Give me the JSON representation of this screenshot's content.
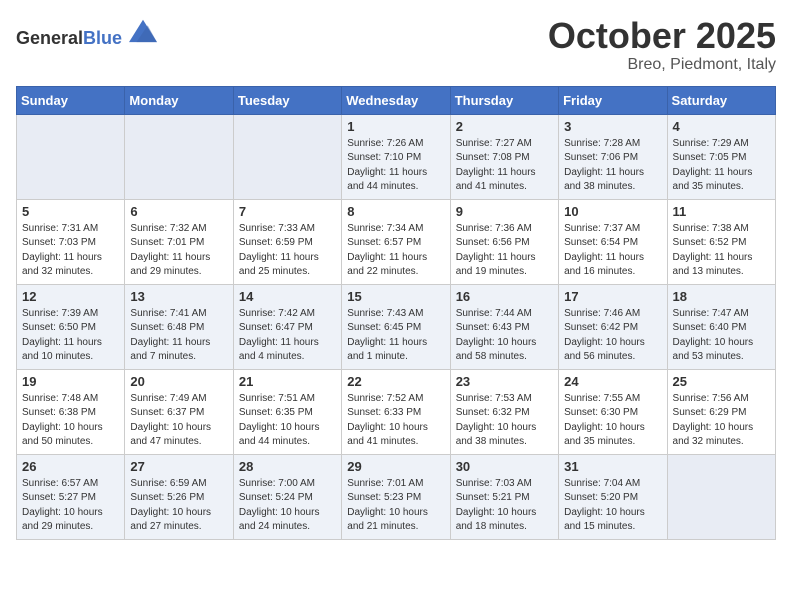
{
  "header": {
    "logo_general": "General",
    "logo_blue": "Blue",
    "month": "October 2025",
    "location": "Breo, Piedmont, Italy"
  },
  "weekdays": [
    "Sunday",
    "Monday",
    "Tuesday",
    "Wednesday",
    "Thursday",
    "Friday",
    "Saturday"
  ],
  "weeks": [
    [
      {
        "day": "",
        "sunrise": "",
        "sunset": "",
        "daylight": ""
      },
      {
        "day": "",
        "sunrise": "",
        "sunset": "",
        "daylight": ""
      },
      {
        "day": "",
        "sunrise": "",
        "sunset": "",
        "daylight": ""
      },
      {
        "day": "1",
        "sunrise": "Sunrise: 7:26 AM",
        "sunset": "Sunset: 7:10 PM",
        "daylight": "Daylight: 11 hours and 44 minutes."
      },
      {
        "day": "2",
        "sunrise": "Sunrise: 7:27 AM",
        "sunset": "Sunset: 7:08 PM",
        "daylight": "Daylight: 11 hours and 41 minutes."
      },
      {
        "day": "3",
        "sunrise": "Sunrise: 7:28 AM",
        "sunset": "Sunset: 7:06 PM",
        "daylight": "Daylight: 11 hours and 38 minutes."
      },
      {
        "day": "4",
        "sunrise": "Sunrise: 7:29 AM",
        "sunset": "Sunset: 7:05 PM",
        "daylight": "Daylight: 11 hours and 35 minutes."
      }
    ],
    [
      {
        "day": "5",
        "sunrise": "Sunrise: 7:31 AM",
        "sunset": "Sunset: 7:03 PM",
        "daylight": "Daylight: 11 hours and 32 minutes."
      },
      {
        "day": "6",
        "sunrise": "Sunrise: 7:32 AM",
        "sunset": "Sunset: 7:01 PM",
        "daylight": "Daylight: 11 hours and 29 minutes."
      },
      {
        "day": "7",
        "sunrise": "Sunrise: 7:33 AM",
        "sunset": "Sunset: 6:59 PM",
        "daylight": "Daylight: 11 hours and 25 minutes."
      },
      {
        "day": "8",
        "sunrise": "Sunrise: 7:34 AM",
        "sunset": "Sunset: 6:57 PM",
        "daylight": "Daylight: 11 hours and 22 minutes."
      },
      {
        "day": "9",
        "sunrise": "Sunrise: 7:36 AM",
        "sunset": "Sunset: 6:56 PM",
        "daylight": "Daylight: 11 hours and 19 minutes."
      },
      {
        "day": "10",
        "sunrise": "Sunrise: 7:37 AM",
        "sunset": "Sunset: 6:54 PM",
        "daylight": "Daylight: 11 hours and 16 minutes."
      },
      {
        "day": "11",
        "sunrise": "Sunrise: 7:38 AM",
        "sunset": "Sunset: 6:52 PM",
        "daylight": "Daylight: 11 hours and 13 minutes."
      }
    ],
    [
      {
        "day": "12",
        "sunrise": "Sunrise: 7:39 AM",
        "sunset": "Sunset: 6:50 PM",
        "daylight": "Daylight: 11 hours and 10 minutes."
      },
      {
        "day": "13",
        "sunrise": "Sunrise: 7:41 AM",
        "sunset": "Sunset: 6:48 PM",
        "daylight": "Daylight: 11 hours and 7 minutes."
      },
      {
        "day": "14",
        "sunrise": "Sunrise: 7:42 AM",
        "sunset": "Sunset: 6:47 PM",
        "daylight": "Daylight: 11 hours and 4 minutes."
      },
      {
        "day": "15",
        "sunrise": "Sunrise: 7:43 AM",
        "sunset": "Sunset: 6:45 PM",
        "daylight": "Daylight: 11 hours and 1 minute."
      },
      {
        "day": "16",
        "sunrise": "Sunrise: 7:44 AM",
        "sunset": "Sunset: 6:43 PM",
        "daylight": "Daylight: 10 hours and 58 minutes."
      },
      {
        "day": "17",
        "sunrise": "Sunrise: 7:46 AM",
        "sunset": "Sunset: 6:42 PM",
        "daylight": "Daylight: 10 hours and 56 minutes."
      },
      {
        "day": "18",
        "sunrise": "Sunrise: 7:47 AM",
        "sunset": "Sunset: 6:40 PM",
        "daylight": "Daylight: 10 hours and 53 minutes."
      }
    ],
    [
      {
        "day": "19",
        "sunrise": "Sunrise: 7:48 AM",
        "sunset": "Sunset: 6:38 PM",
        "daylight": "Daylight: 10 hours and 50 minutes."
      },
      {
        "day": "20",
        "sunrise": "Sunrise: 7:49 AM",
        "sunset": "Sunset: 6:37 PM",
        "daylight": "Daylight: 10 hours and 47 minutes."
      },
      {
        "day": "21",
        "sunrise": "Sunrise: 7:51 AM",
        "sunset": "Sunset: 6:35 PM",
        "daylight": "Daylight: 10 hours and 44 minutes."
      },
      {
        "day": "22",
        "sunrise": "Sunrise: 7:52 AM",
        "sunset": "Sunset: 6:33 PM",
        "daylight": "Daylight: 10 hours and 41 minutes."
      },
      {
        "day": "23",
        "sunrise": "Sunrise: 7:53 AM",
        "sunset": "Sunset: 6:32 PM",
        "daylight": "Daylight: 10 hours and 38 minutes."
      },
      {
        "day": "24",
        "sunrise": "Sunrise: 7:55 AM",
        "sunset": "Sunset: 6:30 PM",
        "daylight": "Daylight: 10 hours and 35 minutes."
      },
      {
        "day": "25",
        "sunrise": "Sunrise: 7:56 AM",
        "sunset": "Sunset: 6:29 PM",
        "daylight": "Daylight: 10 hours and 32 minutes."
      }
    ],
    [
      {
        "day": "26",
        "sunrise": "Sunrise: 6:57 AM",
        "sunset": "Sunset: 5:27 PM",
        "daylight": "Daylight: 10 hours and 29 minutes."
      },
      {
        "day": "27",
        "sunrise": "Sunrise: 6:59 AM",
        "sunset": "Sunset: 5:26 PM",
        "daylight": "Daylight: 10 hours and 27 minutes."
      },
      {
        "day": "28",
        "sunrise": "Sunrise: 7:00 AM",
        "sunset": "Sunset: 5:24 PM",
        "daylight": "Daylight: 10 hours and 24 minutes."
      },
      {
        "day": "29",
        "sunrise": "Sunrise: 7:01 AM",
        "sunset": "Sunset: 5:23 PM",
        "daylight": "Daylight: 10 hours and 21 minutes."
      },
      {
        "day": "30",
        "sunrise": "Sunrise: 7:03 AM",
        "sunset": "Sunset: 5:21 PM",
        "daylight": "Daylight: 10 hours and 18 minutes."
      },
      {
        "day": "31",
        "sunrise": "Sunrise: 7:04 AM",
        "sunset": "Sunset: 5:20 PM",
        "daylight": "Daylight: 10 hours and 15 minutes."
      },
      {
        "day": "",
        "sunrise": "",
        "sunset": "",
        "daylight": ""
      }
    ]
  ]
}
